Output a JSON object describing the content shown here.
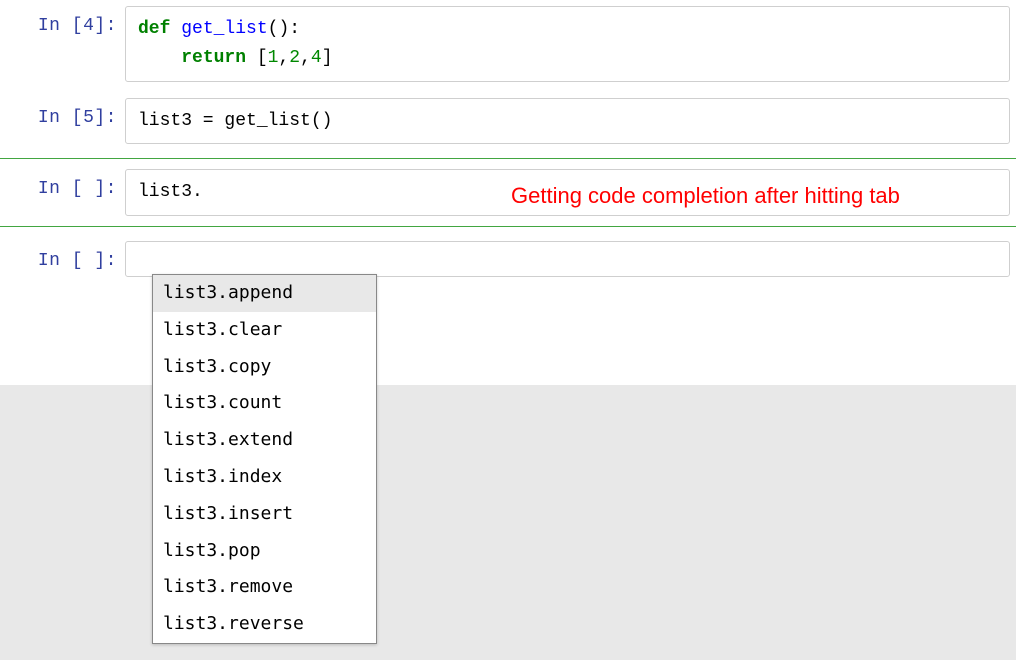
{
  "cells": [
    {
      "prompt": "In [4]:",
      "code_tokens": [
        {
          "line": 0,
          "tokens": [
            {
              "cls": "kw",
              "t": "def"
            },
            {
              "cls": "plain",
              "t": " "
            },
            {
              "cls": "fn",
              "t": "get_list"
            },
            {
              "cls": "plain",
              "t": "():"
            }
          ]
        },
        {
          "line": 1,
          "tokens": [
            {
              "cls": "plain",
              "t": "    "
            },
            {
              "cls": "kw",
              "t": "return"
            },
            {
              "cls": "plain",
              "t": " ["
            },
            {
              "cls": "num",
              "t": "1"
            },
            {
              "cls": "plain",
              "t": ","
            },
            {
              "cls": "num",
              "t": "2"
            },
            {
              "cls": "plain",
              "t": ","
            },
            {
              "cls": "num",
              "t": "4"
            },
            {
              "cls": "plain",
              "t": "]"
            }
          ]
        }
      ],
      "selected": false
    },
    {
      "prompt": "In [5]:",
      "code_tokens": [
        {
          "line": 0,
          "tokens": [
            {
              "cls": "plain",
              "t": "list3 = get_list()"
            }
          ]
        }
      ],
      "selected": false
    },
    {
      "prompt": "In [ ]:",
      "code_tokens": [
        {
          "line": 0,
          "tokens": [
            {
              "cls": "plain",
              "t": "list3."
            }
          ]
        }
      ],
      "selected": true
    },
    {
      "prompt": "In [ ]:",
      "code_tokens": [
        {
          "line": 0,
          "tokens": [
            {
              "cls": "plain",
              "t": ""
            }
          ]
        }
      ],
      "selected": false
    }
  ],
  "annotation": "Getting code completion after hitting tab",
  "completions": [
    "list3.append",
    "list3.clear",
    "list3.copy",
    "list3.count",
    "list3.extend",
    "list3.index",
    "list3.insert",
    "list3.pop",
    "list3.remove",
    "list3.reverse"
  ],
  "completion_selected_index": 0
}
